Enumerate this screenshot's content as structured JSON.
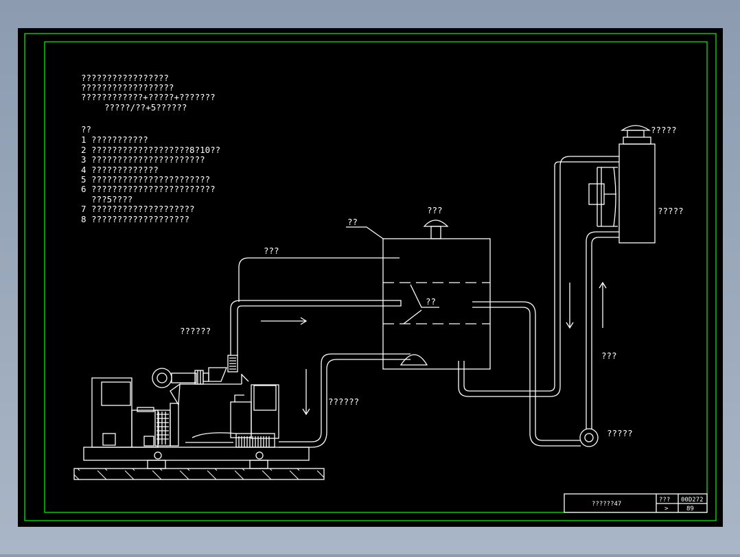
{
  "colors": {
    "background": "#000000",
    "frame": "#00ff00",
    "lines": "#ffffff",
    "outer": "#8c9bb0"
  },
  "notes": {
    "title_lines": [
      "?????????????????",
      "??????????????????",
      "????????????+?????+???????",
      "?????/??+5??????"
    ],
    "heading": "??",
    "items": [
      "1 ???????????",
      "2 ???????????????????8?10??",
      "3 ??????????????????????",
      "4 ?????????????",
      "5 ???????????????????????",
      "6 ????????????????????????",
      "  ???5????",
      "7 ????????????????????",
      "8 ???????????????????"
    ]
  },
  "labels": {
    "vent_cap": "???",
    "tank": "??",
    "overflow_pipe": "???",
    "level": "??",
    "exhaust": "??????",
    "return_pipe": "??????",
    "radiator_cap": "?????",
    "radiator": "?????",
    "supply_pipe": "???",
    "pump": "?????"
  },
  "title_block": {
    "name": "??????47",
    "field_label_1": "???",
    "field_value_1": "00D272",
    "field_label_2": ">",
    "field_value_2": "89"
  }
}
